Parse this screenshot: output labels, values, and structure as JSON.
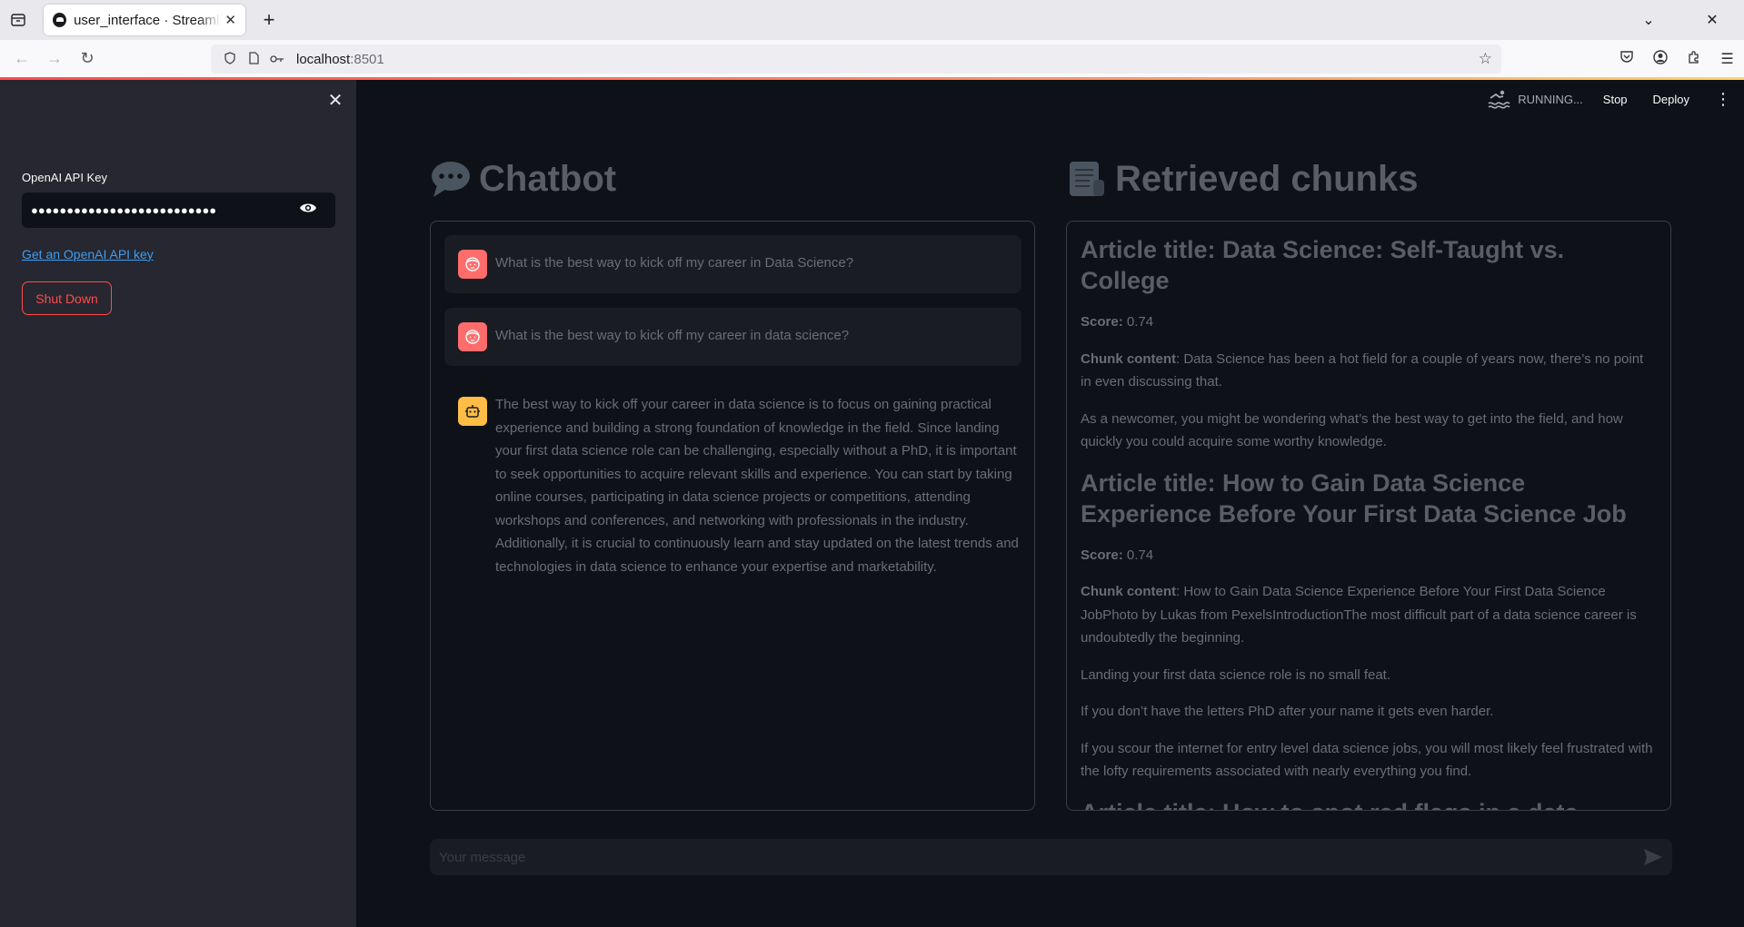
{
  "browser": {
    "tab_title": "user_interface · Streamlit",
    "url_host": "localhost",
    "url_port": ":8501"
  },
  "sidebar": {
    "api_key_label": "OpenAI API Key",
    "api_key_value": "●●●●●●●●●●●●●●●●●●●●●●●●●●",
    "api_link_text": "Get an OpenAI API key",
    "shutdown_label": "Shut Down"
  },
  "topbar": {
    "status": "RUNNING...",
    "stop_label": "Stop",
    "deploy_label": "Deploy"
  },
  "chatbot": {
    "title": "Chatbot",
    "messages": [
      {
        "role": "user",
        "text": "What is the best way to kick off my career in Data Science?"
      },
      {
        "role": "user",
        "text": "What is the best way to kick off my career in data science?"
      },
      {
        "role": "assistant",
        "text": "The best way to kick off your career in data science is to focus on gaining practical experience and building a strong foundation of knowledge in the field. Since landing your first data science role can be challenging, especially without a PhD, it is important to seek opportunities to acquire relevant skills and experience. You can start by taking online courses, participating in data science projects or competitions, attending workshops and conferences, and networking with professionals in the industry. Additionally, it is crucial to continuously learn and stay updated on the latest trends and technologies in data science to enhance your expertise and marketability."
      }
    ]
  },
  "retrieved": {
    "title": "Retrieved chunks",
    "score_label": "Score:",
    "content_label": "Chunk content",
    "chunks": [
      {
        "title": "Article title: Data Science: Self-Taught vs. College",
        "score": "0.74",
        "content": ": Data Science has been a hot field for a couple of years now, there’s no point in even discussing that.",
        "paragraphs": [
          "As a newcomer, you might be wondering what’s the best way to get into the field, and how quickly you could acquire some worthy knowledge."
        ]
      },
      {
        "title": "Article title: How to Gain Data Science Experience Before Your First Data Science Job",
        "score": "0.74",
        "content": ": How to Gain Data Science Experience Before Your First Data Science JobPhoto by Lukas from PexelsIntroductionThe most difficult part of a data science career is undoubtedly the beginning.",
        "paragraphs": [
          "Landing your first data science role is no small feat.",
          "If you don’t have the letters PhD after your name it gets even harder.",
          "If you scour the internet for entry level data science jobs, you will most likely feel frustrated with the lofty requirements associated with nearly everything you find."
        ]
      },
      {
        "title": "Article title: How to spot red flags in a data science",
        "score": "",
        "content": "",
        "paragraphs": []
      }
    ]
  },
  "chat_input": {
    "placeholder": "Your message"
  },
  "colors": {
    "sidebar_bg": "#262730",
    "main_bg": "#0e1117",
    "accent_red": "#ff4b4b",
    "user_avatar": "#ff6c6c",
    "bot_avatar": "#ffbd45",
    "link": "#3d9df3"
  }
}
